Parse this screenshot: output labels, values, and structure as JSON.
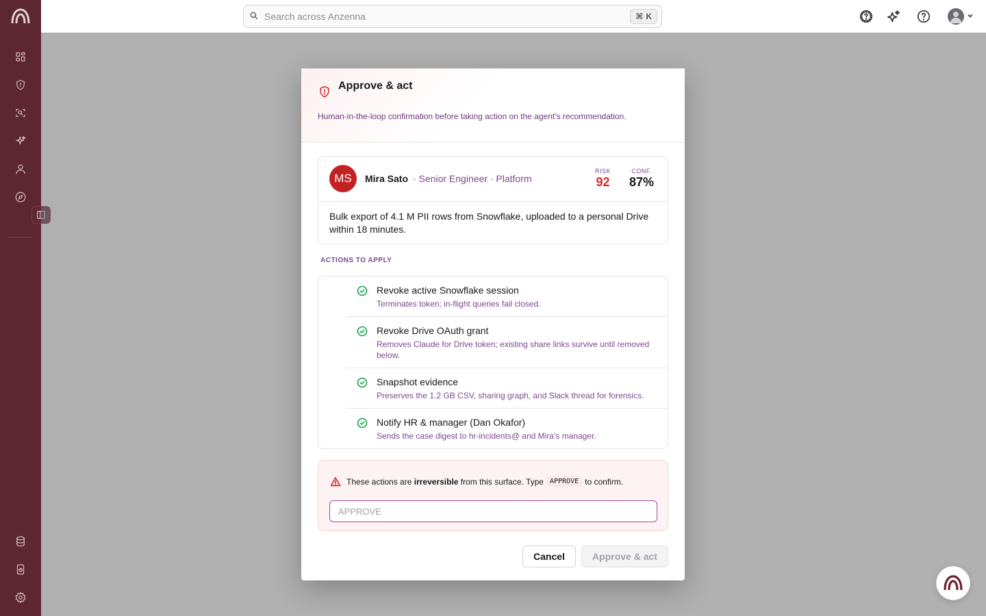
{
  "app": {
    "brand_color": "#5c2632",
    "accent": "#dc2626"
  },
  "search": {
    "placeholder": "Search across Anzenna",
    "shortcut_symbol": "⌘",
    "shortcut_key": "K"
  },
  "sidebar": {
    "items": [
      {
        "icon": "dashboard-icon"
      },
      {
        "icon": "shield-icon"
      },
      {
        "icon": "scan-icon"
      },
      {
        "icon": "sparkles-icon"
      },
      {
        "icon": "user-icon"
      },
      {
        "icon": "compass-icon"
      }
    ],
    "bottom_items": [
      {
        "icon": "database-icon"
      },
      {
        "icon": "device-icon"
      },
      {
        "icon": "gear-icon"
      }
    ]
  },
  "modal": {
    "title": "Approve & act",
    "subtitle": "Human-in-the-loop confirmation before taking action on the agent's recommendation.",
    "person": {
      "initials": "MS",
      "name": "Mira Sato",
      "role": "· Senior Engineer · Platform",
      "risk_label": "RISK",
      "risk_value": "92",
      "conf_label": "CONF.",
      "conf_value": "87%",
      "description": "Bulk export of 4.1 M PII rows from Snowflake, uploaded to a personal Drive within 18 minutes."
    },
    "actions_label": "ACTIONS TO APPLY",
    "actions": [
      {
        "title": "Revoke active Snowflake session",
        "desc": "Terminates token; in-flight queries fail closed."
      },
      {
        "title": "Revoke Drive OAuth grant",
        "desc": "Removes Claude for Drive token; existing share links survive until removed below."
      },
      {
        "title": "Snapshot evidence",
        "desc": "Preserves the 1.2 GB CSV, sharing graph, and Slack thread for forensics."
      },
      {
        "title": "Notify HR & manager (Dan Okafor)",
        "desc": "Sends the case digest to hr-incidents@ and Mira's manager."
      }
    ],
    "warning": {
      "prefix": "These actions are",
      "bold": "irreversible",
      "middle": "from this surface. Type",
      "code": "APPROVE",
      "suffix": "to confirm."
    },
    "confirm_placeholder": "APPROVE",
    "cancel_label": "Cancel",
    "approve_label": "Approve & act"
  }
}
